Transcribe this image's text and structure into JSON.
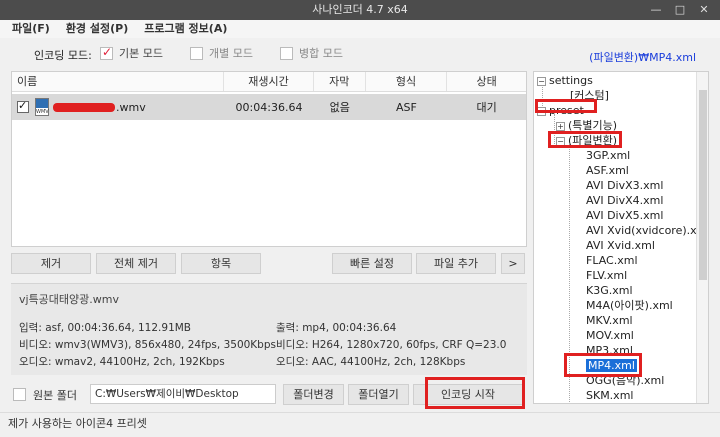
{
  "window": {
    "title": "사나인코더 4.7 x64",
    "buttons": [
      "—",
      "□",
      "✕"
    ]
  },
  "menu": [
    "파일(F)",
    "환경 설정(P)",
    "프로그램 정보(A)"
  ],
  "mode": {
    "label": "인코딩 모드:",
    "options": [
      {
        "label": "기본 모드",
        "checked": true
      },
      {
        "label": "개별 모드",
        "checked": false
      },
      {
        "label": "병합 모드",
        "checked": false
      }
    ],
    "preset_link": "(파일변환)₩MP4.xml"
  },
  "table": {
    "headers": [
      "이름",
      "재생시간",
      "자막",
      "형식",
      "상태"
    ],
    "rows": [
      {
        "name_suffix": ".wmv",
        "duration": "00:04:36.64",
        "subtitle": "없음",
        "format": "ASF",
        "status": "대기",
        "icon_label": "WMV"
      }
    ]
  },
  "buttons": {
    "remove": "제거",
    "remove_all": "전체 제거",
    "item": "항목",
    "quick_settings": "빠른 설정",
    "add_file": "파일 추가",
    "more": ">"
  },
  "info": {
    "filename": "vj특공대태양광.wmv",
    "input": "입력: asf, 00:04:36.64, 112.91MB",
    "output": "출력: mp4, 00:04:36.64",
    "video_in": "비디오: wmv3(WMV3), 856x480, 24fps, 3500Kbps",
    "video_out": "비디오: H264, 1280x720, 60fps, CRF Q=23.0",
    "audio_in": "오디오: wmav2, 44100Hz, 2ch, 192Kbps",
    "audio_out": "오디오: AAC, 44100Hz, 2ch, 128Kbps"
  },
  "folder": {
    "source_label": "원본 폴더",
    "path": "C:₩Users₩제이비₩Desktop",
    "change_button": "폴더변경",
    "open_button": "폴더열기",
    "start_button": "인코딩 시작"
  },
  "status": "제가 사용하는 아이콘4 프리셋",
  "tree": {
    "root": "settings",
    "custom": "[커스텀]",
    "preset": "preset",
    "special": "(특별기능)",
    "convert": "(파일변환)",
    "files": [
      "3GP.xml",
      "ASF.xml",
      "AVI DivX3.xml",
      "AVI DivX4.xml",
      "AVI DivX5.xml",
      "AVI Xvid(xvidcore).xml",
      "AVI Xvid.xml",
      "FLAC.xml",
      "FLV.xml",
      "K3G.xml",
      "M4A(아이팟).xml",
      "MKV.xml",
      "MOV.xml",
      "MP3.xml",
      "MP4.xml",
      "OGG(음악).xml",
      "SKM.xml"
    ],
    "selected": "MP4.xml"
  },
  "colors": {
    "title_bg": "#4c4c4c",
    "highlight": "#e02020",
    "link": "#1a3ddb",
    "selection": "#1a6fd8"
  }
}
